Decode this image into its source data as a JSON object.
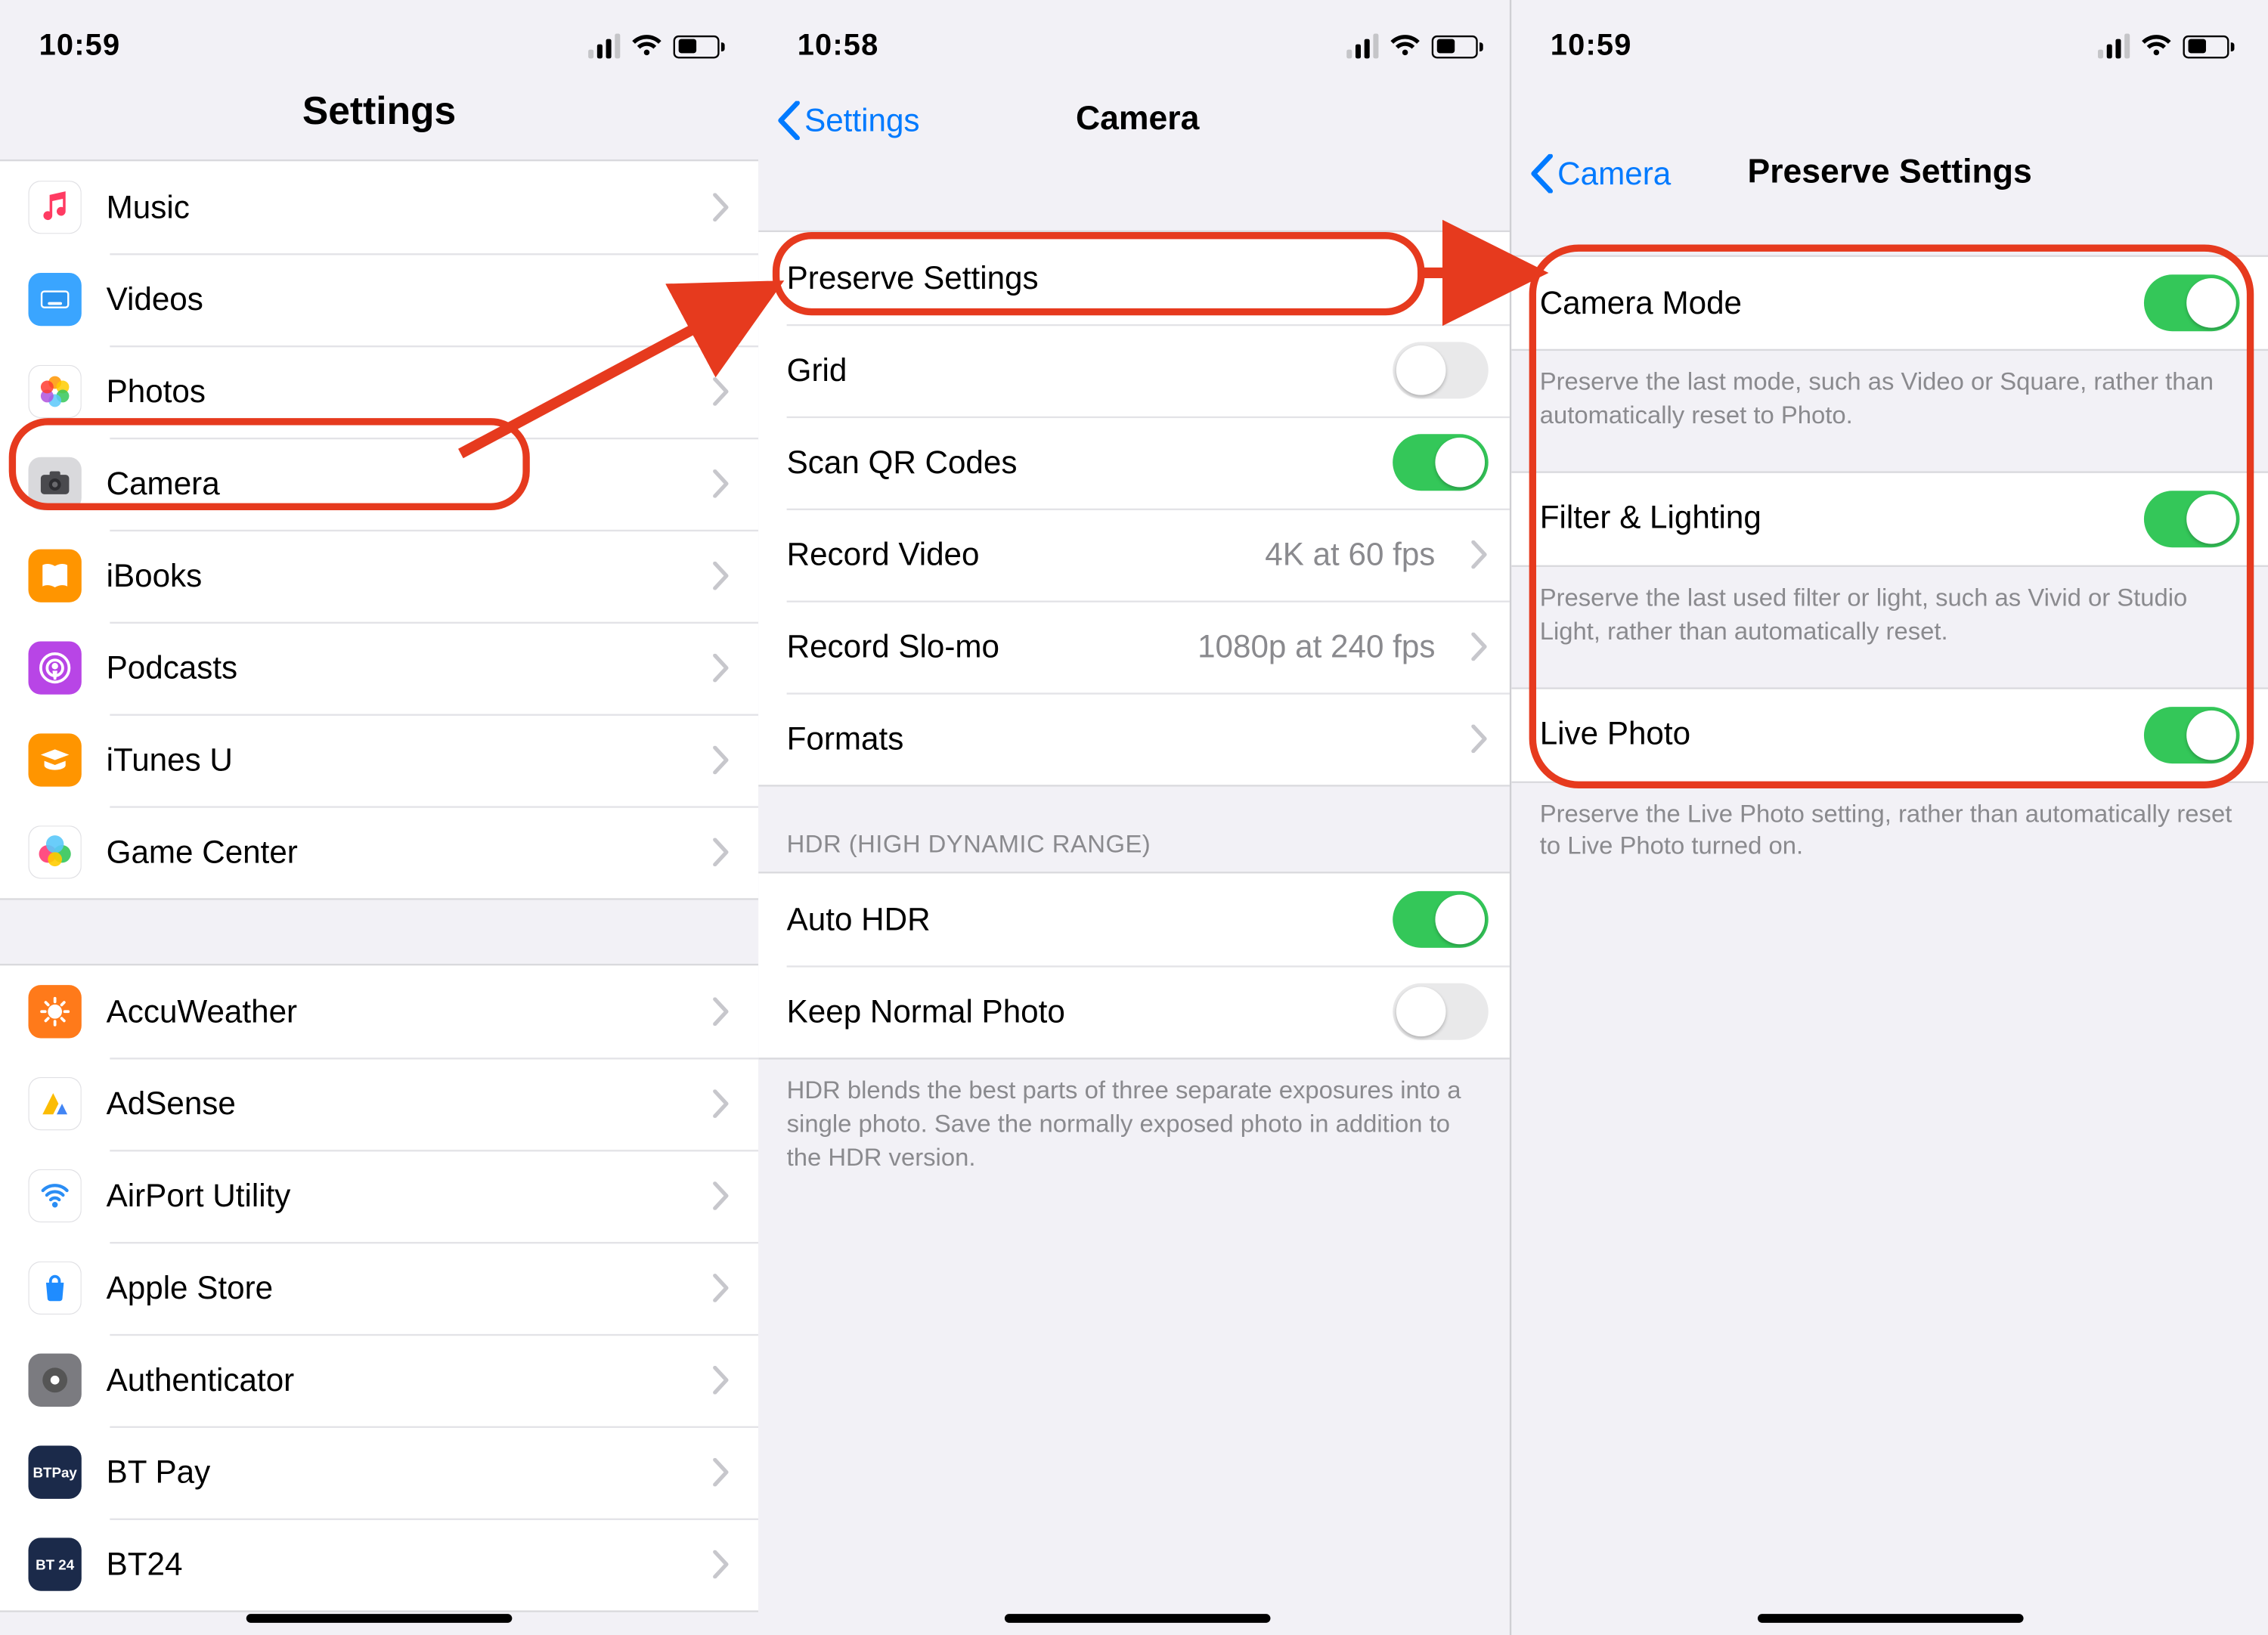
{
  "screens": {
    "settings": {
      "time": "10:59",
      "title": "Settings",
      "groups": [
        {
          "rows": [
            {
              "id": "music",
              "label": "Music",
              "icon": "music"
            },
            {
              "id": "videos",
              "label": "Videos",
              "icon": "videos"
            },
            {
              "id": "photos",
              "label": "Photos",
              "icon": "photos"
            },
            {
              "id": "camera",
              "label": "Camera",
              "icon": "camera"
            },
            {
              "id": "ibooks",
              "label": "iBooks",
              "icon": "ibooks"
            },
            {
              "id": "podcasts",
              "label": "Podcasts",
              "icon": "podcasts"
            },
            {
              "id": "itunesu",
              "label": "iTunes U",
              "icon": "itunesu"
            },
            {
              "id": "gamecenter",
              "label": "Game Center",
              "icon": "gamecenter"
            }
          ]
        },
        {
          "rows": [
            {
              "id": "accuweather",
              "label": "AccuWeather",
              "icon": "accuweather"
            },
            {
              "id": "adsense",
              "label": "AdSense",
              "icon": "adsense"
            },
            {
              "id": "airport",
              "label": "AirPort Utility",
              "icon": "airport"
            },
            {
              "id": "applestore",
              "label": "Apple Store",
              "icon": "applestore"
            },
            {
              "id": "authenticator",
              "label": "Authenticator",
              "icon": "authenticator"
            },
            {
              "id": "btpay",
              "label": "BT Pay",
              "icon": "btpay"
            },
            {
              "id": "bt24",
              "label": "BT24",
              "icon": "bt24"
            }
          ]
        }
      ]
    },
    "camera": {
      "time": "10:58",
      "back_label": "Settings",
      "title": "Camera",
      "group1": [
        {
          "id": "preserve",
          "label": "Preserve Settings",
          "type": "nav"
        },
        {
          "id": "grid",
          "label": "Grid",
          "type": "switch",
          "on": false
        },
        {
          "id": "scanqr",
          "label": "Scan QR Codes",
          "type": "switch",
          "on": true
        },
        {
          "id": "recvideo",
          "label": "Record Video",
          "type": "value",
          "value": "4K at 60 fps"
        },
        {
          "id": "recslo",
          "label": "Record Slo-mo",
          "type": "value",
          "value": "1080p at 240 fps"
        },
        {
          "id": "formats",
          "label": "Formats",
          "type": "nav"
        }
      ],
      "hdr_header": "HDR (HIGH DYNAMIC RANGE)",
      "group2": [
        {
          "id": "autohdr",
          "label": "Auto HDR",
          "type": "switch",
          "on": true
        },
        {
          "id": "keepnorm",
          "label": "Keep Normal Photo",
          "type": "switch",
          "on": false
        }
      ],
      "hdr_footer": "HDR blends the best parts of three separate exposures into a single photo. Save the normally exposed photo in addition to the HDR version."
    },
    "preserve": {
      "time": "10:59",
      "back_label": "Camera",
      "title": "Preserve Settings",
      "rows": [
        {
          "id": "cammode",
          "label": "Camera Mode",
          "on": true,
          "footer": "Preserve the last mode, such as Video or Square, rather than automatically reset to Photo."
        },
        {
          "id": "filter",
          "label": "Filter & Lighting",
          "on": true,
          "footer": "Preserve the last used filter or light, such as Vivid or Studio Light, rather than automatically reset."
        },
        {
          "id": "livephoto",
          "label": "Live Photo",
          "on": true,
          "footer": "Preserve the Live Photo setting, rather than automatically reset to Live Photo turned on."
        }
      ]
    }
  },
  "icon_colors": {
    "music": "#ffffff",
    "videos": "#3aa5ff",
    "photos": "#ffffff",
    "camera": "#d9d9dc",
    "ibooks": "#ff9500",
    "podcasts": "#b845e6",
    "itunesu": "#ff9500",
    "gamecenter": "#ffffff",
    "accuweather": "#ff7a1a",
    "adsense": "#ffffff",
    "airport": "#ffffff",
    "applestore": "#ffffff",
    "authenticator": "#7b7b80",
    "btpay": "#1b2a4a",
    "bt24": "#1b2a4a"
  },
  "annotation_color": "#e63a1e"
}
